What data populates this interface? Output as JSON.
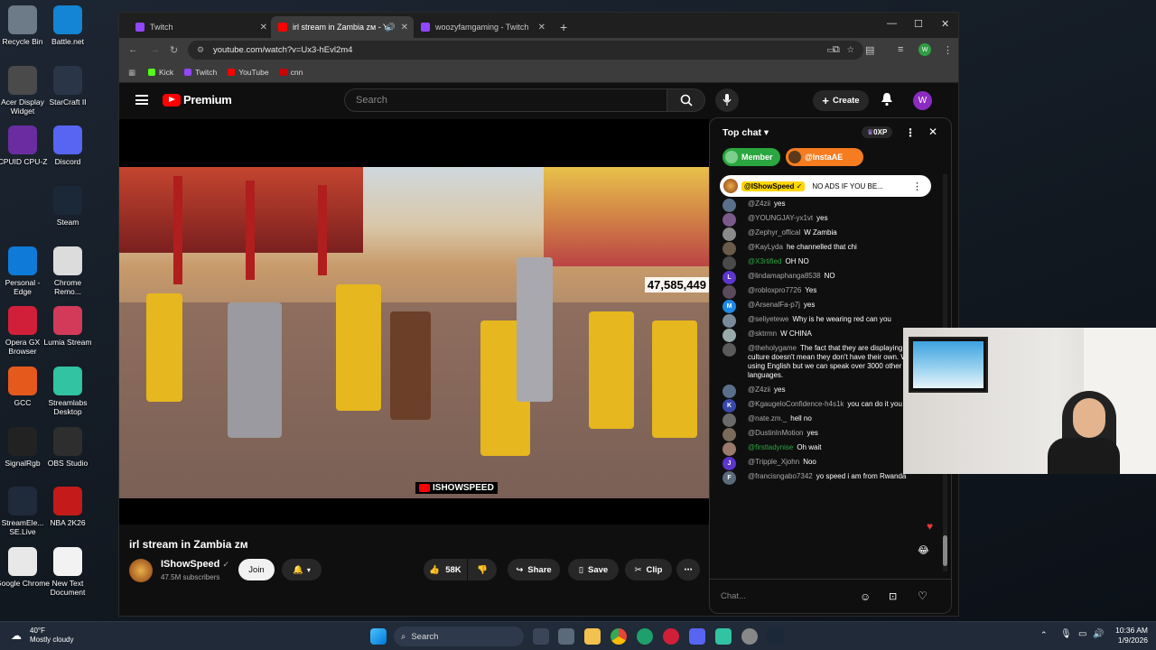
{
  "desktop_icons": [
    {
      "label": "Recycle Bin",
      "icon": "recycle-bin-icon",
      "color": "#6d7a88"
    },
    {
      "label": "Battle.net",
      "icon": "battlenet-icon",
      "color": "#1484d4"
    },
    {
      "label": "Acer Display Widget",
      "icon": "acer-display-icon",
      "color": "#4a4a4a"
    },
    {
      "label": "StarCraft II",
      "icon": "starcraft-icon",
      "color": "#2a3548"
    },
    {
      "label": "CPUID CPU-Z",
      "icon": "cpuz-icon",
      "color": "#6a2ca0"
    },
    {
      "label": "Discord",
      "icon": "discord-icon",
      "color": "#5865f2"
    },
    {
      "label": "Steam",
      "icon": "steam-icon",
      "color": "#1b2838"
    },
    {
      "label": "Personal - Edge",
      "icon": "edge-icon",
      "color": "#0f7ad8"
    },
    {
      "label": "Chrome Remo...",
      "icon": "chrome-remote-icon",
      "color": "#dcdcdc"
    },
    {
      "label": "Opera GX Browser",
      "icon": "opera-gx-icon",
      "color": "#d11f3a"
    },
    {
      "label": "Lumia Stream",
      "icon": "lumia-icon",
      "color": "#d33a5a"
    },
    {
      "label": "GCC",
      "icon": "gcc-icon",
      "color": "#e5591d"
    },
    {
      "label": "Streamlabs Desktop",
      "icon": "streamlabs-icon",
      "color": "#31c3a2"
    },
    {
      "label": "SignalRgb",
      "icon": "signalrgb-icon",
      "color": "#222"
    },
    {
      "label": "OBS Studio",
      "icon": "obs-icon",
      "color": "#2e2e2e"
    },
    {
      "label": "StreamEle... SE.Live",
      "icon": "streamelements-icon",
      "color": "#1f2a3b"
    },
    {
      "label": "NBA 2K26",
      "icon": "nba2k-icon",
      "color": "#c41a1a"
    },
    {
      "label": "Google Chrome",
      "icon": "chrome-icon",
      "color": "#e8e8e8"
    },
    {
      "label": "New Text Document",
      "icon": "text-document-icon",
      "color": "#f2f2f2"
    }
  ],
  "browser": {
    "tabs": [
      {
        "title": "Twitch",
        "active": false,
        "color": "#9146ff"
      },
      {
        "title": "irl stream in Zambia ᴢᴍ - Yo",
        "active": true,
        "color": "#ff0000"
      },
      {
        "title": "woozyfamgaming - Twitch",
        "active": false,
        "color": "#9146ff"
      }
    ],
    "url": "youtube.com/watch?v=Ux3-hEvl2m4",
    "bookmarks": [
      {
        "label": "Kick",
        "color": "#53fc18"
      },
      {
        "label": "Twitch",
        "color": "#9146ff"
      },
      {
        "label": "YouTube",
        "color": "#ff0000"
      },
      {
        "label": "cnn",
        "color": "#cc0000"
      }
    ],
    "profile_letter": "W"
  },
  "youtube": {
    "logo_text": "Premium",
    "search_placeholder": "Search",
    "create_label": "Create",
    "avatar_letter": "W",
    "video": {
      "counter": "47,585,449",
      "watermark": "ISHOWSPEED",
      "title": "irl stream in Zambia ᴢᴍ"
    },
    "channel": {
      "name": "IShowSpeed",
      "subscribers": "47.5M subscribers",
      "join_label": "Join"
    },
    "actions": {
      "likes": "58K",
      "share": "Share",
      "save": "Save",
      "clip": "Clip"
    }
  },
  "chat": {
    "header": "Top chat",
    "xp_badge": "0XP",
    "member_label": "Member",
    "insta_label": "@InstaAE",
    "pinned": {
      "author": "@IShowSpeed",
      "text": "NO ADS IF YOU BE..."
    },
    "messages": [
      {
        "author": "@Z4zii",
        "text": "yes",
        "color": "#5a6f8a",
        "initial": "",
        "green": false
      },
      {
        "author": "@YOUNGJAY-yx1vt",
        "text": "yes",
        "color": "#7a5a8a",
        "initial": "",
        "green": false
      },
      {
        "author": "@Zephyr_offical",
        "text": "W Zambia",
        "color": "#8a8a8a",
        "initial": "",
        "green": false
      },
      {
        "author": "@KayLyda",
        "text": "he channelled that chi",
        "color": "#6a5a4a",
        "initial": "",
        "green": false
      },
      {
        "author": "@X3rtified",
        "text": "OH NO",
        "color": "#4a4a4a",
        "initial": "",
        "green": true
      },
      {
        "author": "@lindamaphanga8538",
        "text": "NO",
        "color": "#5c35cc",
        "initial": "L",
        "green": false
      },
      {
        "author": "@robloxpro7726",
        "text": "Yes",
        "color": "#5a4a5a",
        "initial": "",
        "green": false
      },
      {
        "author": "@ArsenalFa-p7j",
        "text": "yes",
        "color": "#1e88e5",
        "initial": "M",
        "green": false
      },
      {
        "author": "@seliyetewe",
        "text": "Why is he wearing red can you",
        "color": "#7a8a9a",
        "initial": "",
        "green": false
      },
      {
        "author": "@sktrmn",
        "text": "W CHINA",
        "color": "#9aa",
        "initial": "",
        "green": false
      },
      {
        "author": "@theholygame",
        "text": "The fact that they are displaying Chinese culture doesn't mean they don't have their own. We are using English but we can speak over 3000 other African languages.",
        "color": "#5a5a5a",
        "initial": "",
        "green": false
      },
      {
        "author": "@Z4zii",
        "text": "yes",
        "color": "#5a6f8a",
        "initial": "",
        "green": false
      },
      {
        "author": "@KgaugeloConfidence-h4s1k",
        "text": "you can do it you love you",
        "color": "#3949ab",
        "initial": "K",
        "green": false
      },
      {
        "author": "@nate.zm._",
        "text": "hell no",
        "color": "#6a6a6a",
        "initial": "",
        "green": false
      },
      {
        "author": "@DustinInMotion",
        "text": "yes",
        "color": "#7a6a5a",
        "initial": "",
        "green": false
      },
      {
        "author": "@firstladynise",
        "text": "Oh wait",
        "color": "#9a7a6a",
        "initial": "",
        "green": true
      },
      {
        "author": "@Tripple_Xjohn",
        "text": "Noo",
        "color": "#5c35cc",
        "initial": "J",
        "green": false
      },
      {
        "author": "@francisngabo7342",
        "text": "yo speed i am from Rwanda",
        "color": "#5a6a7a",
        "initial": "F",
        "green": false
      }
    ],
    "input_placeholder": "Chat..."
  },
  "taskbar": {
    "weather_temp": "40°F",
    "weather_desc": "Mostly cloudy",
    "search_label": "Search",
    "time": "10:36 AM",
    "date": "1/9/2026"
  }
}
